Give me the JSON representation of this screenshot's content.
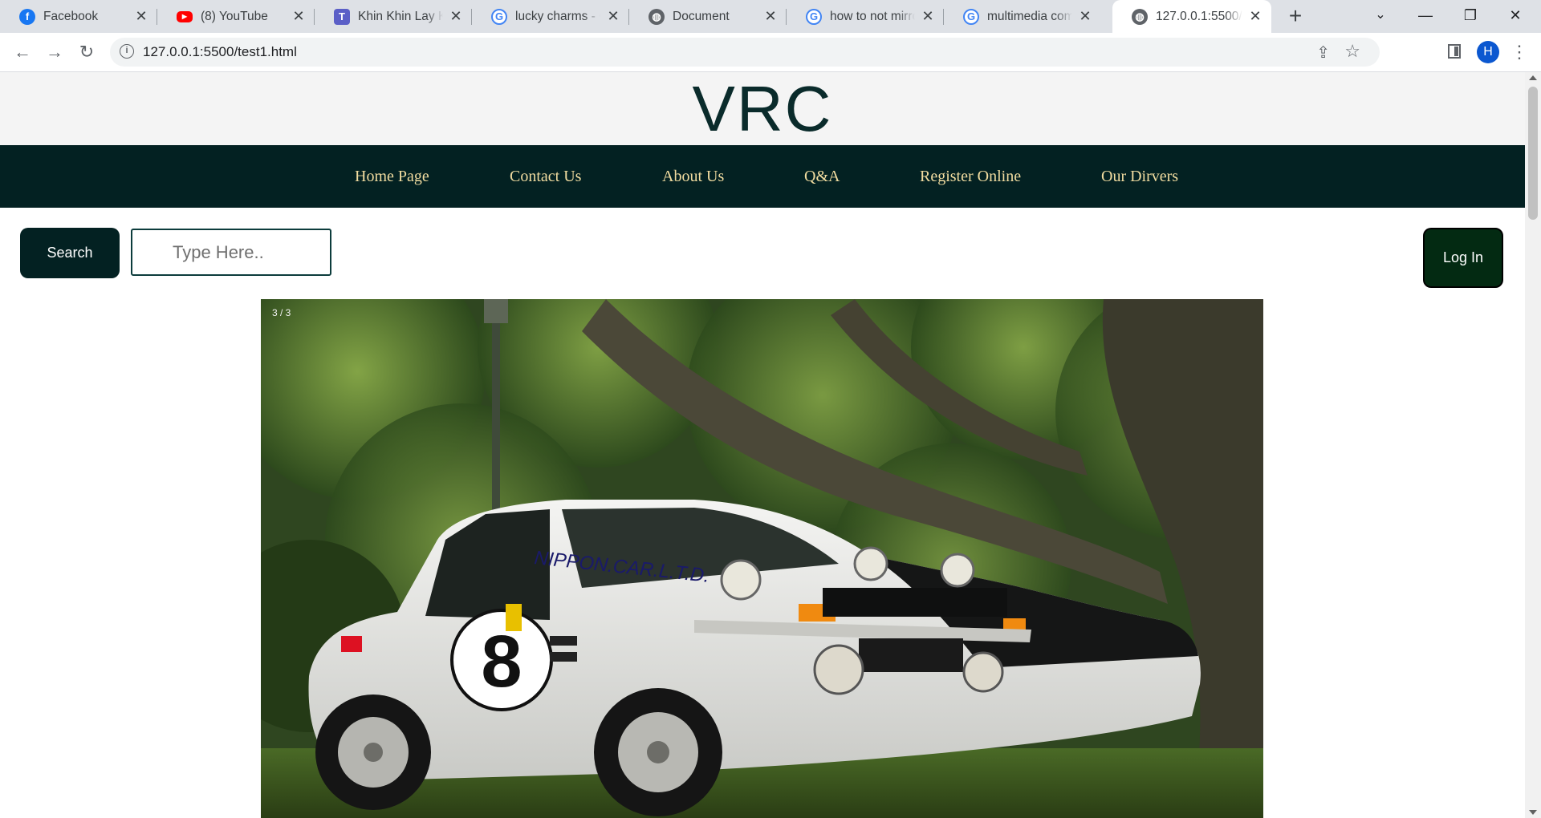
{
  "browser": {
    "tabs": [
      {
        "title": "Facebook",
        "icon": "facebook-icon",
        "color": "#1877f2"
      },
      {
        "title": "(8) YouTube",
        "icon": "youtube-icon",
        "color": "#ff0000"
      },
      {
        "title": "Khin Khin Lay Koo",
        "icon": "teams-icon",
        "color": "#5b5fc7"
      },
      {
        "title": "lucky charms - Go",
        "icon": "google-icon",
        "color": "#4285f4"
      },
      {
        "title": "Document",
        "icon": "globe-icon",
        "color": "#5f6368"
      },
      {
        "title": "how to not mirror",
        "icon": "google-icon",
        "color": "#4285f4"
      },
      {
        "title": "multimedia comp",
        "icon": "google-icon",
        "color": "#4285f4"
      },
      {
        "title": "127.0.0.1:5500/test",
        "icon": "globe-icon",
        "color": "#5f6368"
      }
    ],
    "url": "127.0.0.1:5500/test1.html",
    "profile_initial": "H"
  },
  "site": {
    "logo": "VRC",
    "nav": [
      "Home Page",
      "Contact Us",
      "About Us",
      "Q&A",
      "Register Online",
      "Our Dirvers"
    ],
    "search_label": "Search",
    "search_placeholder": "Type Here..",
    "login_label": "Log In",
    "slide_counter": "3 / 3",
    "car_number": "8",
    "car_decal": "NIPPON.CAR.L.T.D."
  },
  "colors": {
    "nav_bg": "#032122",
    "nav_text": "#f1dca0",
    "logo": "#0a2b2b",
    "login_bg": "#032a12"
  }
}
